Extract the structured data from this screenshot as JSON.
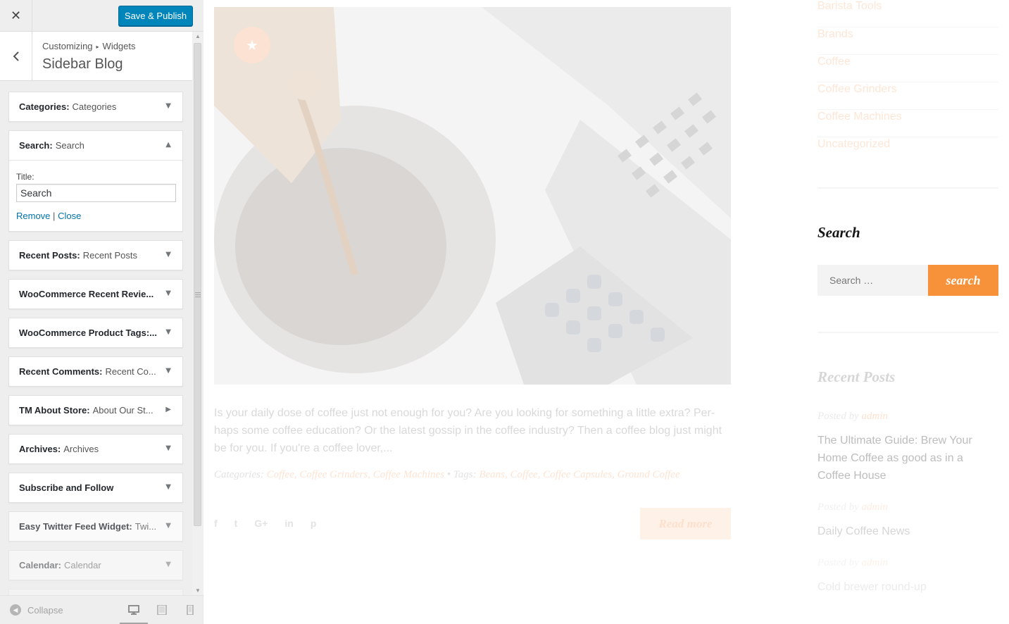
{
  "customizer": {
    "close_icon": "close-icon",
    "publish_label": "Save & Publish",
    "breadcrumb": {
      "root": "Customizing",
      "separator": "▸",
      "current": "Widgets"
    },
    "section_title": "Sidebar Blog",
    "widgets": [
      {
        "type": "Categories:",
        "title": "Categories",
        "state": "collapsed"
      },
      {
        "type": "Search:",
        "title": "Search",
        "state": "expanded"
      },
      {
        "type": "Recent Posts:",
        "title": "Recent Posts",
        "state": "collapsed"
      },
      {
        "type": "WooCommerce Recent Revie...",
        "title": "",
        "state": "collapsed"
      },
      {
        "type": "WooCommerce Product Tags:...",
        "title": "",
        "state": "collapsed"
      },
      {
        "type": "Recent Comments:",
        "title": "Recent Co...",
        "state": "collapsed"
      },
      {
        "type": "TM About Store:",
        "title": "About Our St...",
        "state": "collapsed-right"
      },
      {
        "type": "Archives:",
        "title": "Archives",
        "state": "collapsed"
      },
      {
        "type": "Subscribe and Follow",
        "title": "",
        "state": "collapsed"
      },
      {
        "type": "Easy Twitter Feed Widget:",
        "title": "Twi...",
        "state": "collapsed"
      },
      {
        "type": "Calendar:",
        "title": "Calendar",
        "state": "collapsed"
      }
    ],
    "search_widget": {
      "title_label": "Title:",
      "title_value": "Search",
      "remove_label": "Remove",
      "divider": "|",
      "close_label": "Close"
    },
    "footer": {
      "collapse_label": "Collapse",
      "devices": [
        "desktop",
        "tablet",
        "mobile"
      ],
      "active_device": "desktop"
    }
  },
  "preview": {
    "excerpt": "Is your daily dose of coffee just not enough for you? Are you looking for something a little extra? Per-haps some coffee education? Or the latest gossip in the coffee industry? Then a coffee blog just might be for you. If you're a coffee lover,...",
    "meta": {
      "categories_label": "Categories:",
      "categories": "Coffee, Coffee Grinders, Coffee Machines",
      "bullet": "•",
      "tags_label": "Tags:",
      "tags": "Beans, Coffee, Coffee Capsules, Ground Coffee"
    },
    "share_icons": [
      "f",
      "t",
      "G+",
      "in",
      "p"
    ],
    "read_more": "Read more",
    "sidebar": {
      "categories": [
        "Barista Tools",
        "Brands",
        "Coffee",
        "Coffee Grinders",
        "Coffee Machines",
        "Uncategorized"
      ],
      "search_title": "Search",
      "search_placeholder": "Search …",
      "search_button": "search",
      "recent_posts_title": "Recent Posts",
      "recent_posts": [
        {
          "posted_by": "Posted by",
          "author": "admin",
          "title": "The Ultimate Guide: Brew Your Home Coffee as good as in a Coffee House"
        },
        {
          "posted_by": "Posted by",
          "author": "admin",
          "title": "Daily Coffee News"
        },
        {
          "posted_by": "Posted by",
          "author": "admin",
          "title": "Cold brewer round-up"
        }
      ]
    }
  }
}
